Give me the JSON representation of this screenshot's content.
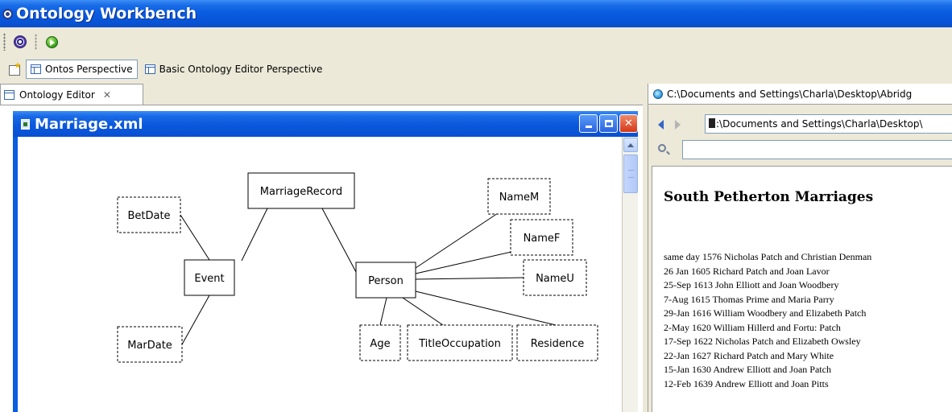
{
  "window": {
    "title": "Ontology Workbench"
  },
  "perspectives": [
    {
      "label": "Ontos Perspective",
      "active": true
    },
    {
      "label": "Basic Ontology Editor Perspective",
      "active": false
    }
  ],
  "editor_view": {
    "tab_label": "Ontology Editor",
    "close_glyph": "✕"
  },
  "internal_frame": {
    "title": "Marriage.xml",
    "buttons": {
      "minimize": "",
      "restore": "",
      "close": "✕"
    }
  },
  "diagram": {
    "nodes": [
      {
        "id": "MarriageRecord",
        "label": "MarriageRecord",
        "dashed": false
      },
      {
        "id": "BetDate",
        "label": "BetDate",
        "dashed": true
      },
      {
        "id": "Event",
        "label": "Event",
        "dashed": false
      },
      {
        "id": "MarDate",
        "label": "MarDate",
        "dashed": true
      },
      {
        "id": "Person",
        "label": "Person",
        "dashed": false
      },
      {
        "id": "NameM",
        "label": "NameM",
        "dashed": true
      },
      {
        "id": "NameF",
        "label": "NameF",
        "dashed": true
      },
      {
        "id": "NameU",
        "label": "NameU",
        "dashed": true
      },
      {
        "id": "Age",
        "label": "Age",
        "dashed": true
      },
      {
        "id": "TitleOccupation",
        "label": "TitleOccupation",
        "dashed": true
      },
      {
        "id": "Residence",
        "label": "Residence",
        "dashed": true
      }
    ],
    "edges": [
      [
        "BetDate",
        "Event"
      ],
      [
        "Event",
        "MarriageRecord"
      ],
      [
        "MarDate",
        "Event"
      ],
      [
        "MarriageRecord",
        "Person"
      ],
      [
        "Person",
        "NameM"
      ],
      [
        "Person",
        "NameF"
      ],
      [
        "Person",
        "NameU"
      ],
      [
        "Person",
        "Age"
      ],
      [
        "Person",
        "TitleOccupation"
      ],
      [
        "Person",
        "Residence"
      ]
    ]
  },
  "browser": {
    "tab_title": "C:\\Documents and Settings\\Charla\\Desktop\\Abridg",
    "address_value": ":\\Documents and Settings\\Charla\\Desktop\\",
    "search_value": "",
    "page": {
      "heading": "South Petherton Marriages",
      "entries": [
        "same day 1576 Nicholas Patch and Christian Denman",
        "26 Jan 1605 Richard Patch and Joan Lavor",
        "25-Sep 1613 John Elliott and Joan Woodbery",
        "7-Aug 1615 Thomas Prime and Maria Parry",
        "29-Jan 1616 William Woodbery and Elizabeth Patch",
        "2-May 1620 William Hillerd and Fortu: Patch",
        "17-Sep 1622 Nicholas Patch and Elizabeth Owsley",
        "22-Jan 1627 Richard Patch and Mary White",
        "15-Jan 1630 Andrew Elliott and Joan Patch",
        "12-Feb 1639 Andrew Elliott and Joan Pitts"
      ]
    }
  }
}
